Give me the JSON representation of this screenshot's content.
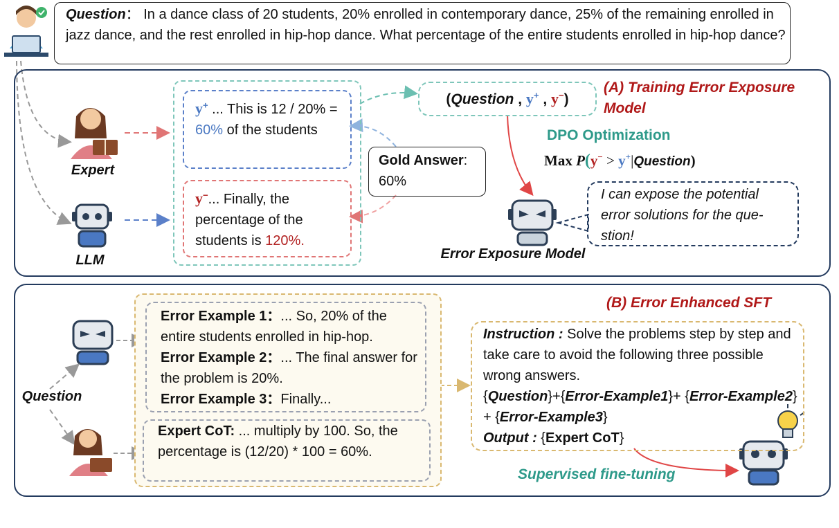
{
  "question_box": {
    "label": "Question",
    "colon": "：",
    "text": "In a dance class of 20 students, 20% enrolled in contemporary dance, 25% of the remaining enrolled in jazz dance, and the rest enrolled in hip-hop dance. What percentage of the entire students enrolled in hip-hop dance?"
  },
  "panel_a": {
    "title_line1": "(A) Training Error Exposure",
    "title_line2": "Model",
    "expert_label": "Expert",
    "llm_label": "LLM",
    "y_plus_symbol": "y",
    "y_minus_symbol": "y",
    "plus_sup": "+",
    "minus_sup": "−",
    "y_plus_text_a": " ... This is 12 / 20% = ",
    "y_plus_highlight": "60%",
    "y_plus_text_b": " of the students",
    "y_minus_text_a": "... Finally, the percentage of the students is ",
    "y_minus_highlight": "120%.",
    "gold_label": "Gold Answer",
    "gold_colon": ":",
    "gold_value": "60%",
    "tuple_open": "(",
    "tuple_question": "Question",
    "tuple_comma": " , ",
    "tuple_close": ")",
    "dpo_label": "DPO Optimization",
    "formula_max": "Max",
    "formula_p": "P",
    "formula_gt": " > ",
    "formula_bar": "|",
    "formula_question": "Question",
    "model_label": "Error Exposure Model",
    "speech": "I can expose the  potential error solutions for the que-stion!"
  },
  "panel_b": {
    "title": "(B) Error Enhanced SFT",
    "question_label": "Question",
    "errors": [
      {
        "label": "Error Example 1：",
        "text": "... So, 20% of the entire students enrolled in hip-hop."
      },
      {
        "label": "Error Example 2：",
        "text": "... The final answer for the problem is 20%."
      },
      {
        "label": "Error Example 3：",
        "text": "Finally..."
      }
    ],
    "cot_label": "Expert CoT:",
    "cot_text": " ... multiply by 100. So, the percentage is (12/20) * 100 = 60%.",
    "instruction_label": "Instruction :",
    "instruction_text": " Solve the problems step by step and take care to avoid the following three possible wrong answers.",
    "tpl_q": "Question",
    "tpl_e1": "Error-Example1",
    "tpl_e2": "Error-Example2",
    "tpl_e3": "Error-Example3",
    "output_label": "Output :",
    "output_value": "Expert CoT",
    "sft_label": "Supervised fine-tuning"
  },
  "colors": {
    "navy": "#233a5e",
    "teal": "#2e9a8a",
    "blue": "#4a78c2",
    "red": "#b22222",
    "gold": "#c9a84c"
  }
}
